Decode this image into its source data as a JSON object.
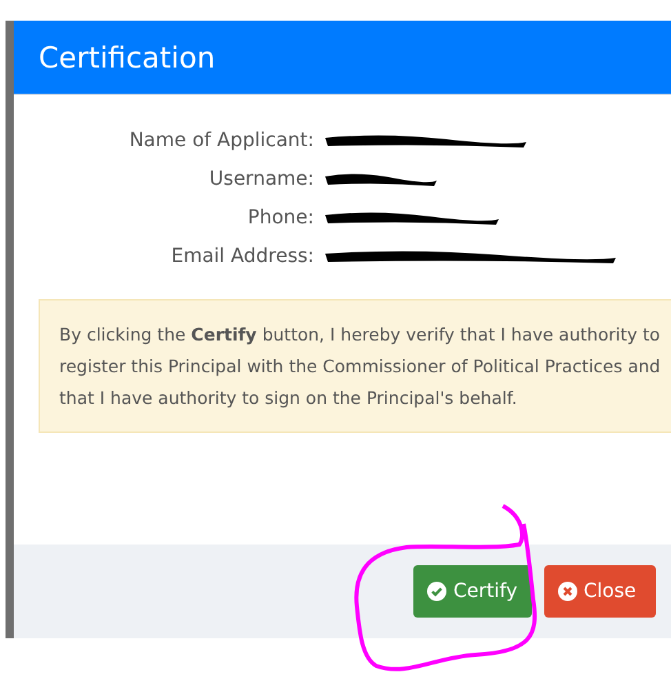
{
  "modal": {
    "title": "Certification",
    "fields": [
      {
        "label": "Name of Applicant:"
      },
      {
        "label": "Username:"
      },
      {
        "label": "Phone:"
      },
      {
        "label": "Email Address:"
      }
    ],
    "notice": "By clicking the **Certify** button, I hereby verify that I have authority to register this Principal with the Commissioner of Political Practices and that I have authority to sign on the Principal's behalf.",
    "buttons": [
      {
        "label": "Certify",
        "kind": "confirm"
      },
      {
        "label": "Close",
        "kind": "close"
      }
    ]
  }
}
